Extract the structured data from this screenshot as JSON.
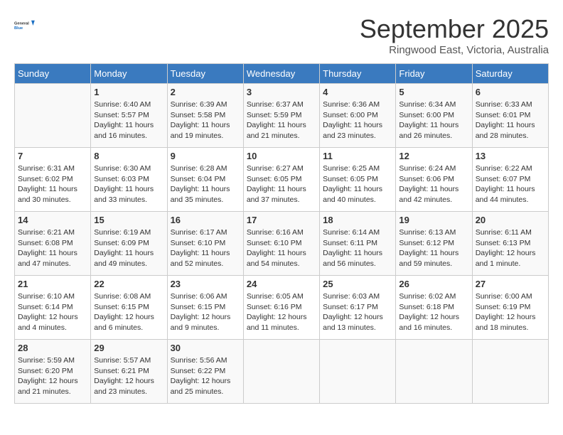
{
  "header": {
    "logo_line1": "General",
    "logo_line2": "Blue",
    "month": "September 2025",
    "location": "Ringwood East, Victoria, Australia"
  },
  "weekdays": [
    "Sunday",
    "Monday",
    "Tuesday",
    "Wednesday",
    "Thursday",
    "Friday",
    "Saturday"
  ],
  "weeks": [
    [
      {
        "day": "",
        "info": ""
      },
      {
        "day": "1",
        "info": "Sunrise: 6:40 AM\nSunset: 5:57 PM\nDaylight: 11 hours\nand 16 minutes."
      },
      {
        "day": "2",
        "info": "Sunrise: 6:39 AM\nSunset: 5:58 PM\nDaylight: 11 hours\nand 19 minutes."
      },
      {
        "day": "3",
        "info": "Sunrise: 6:37 AM\nSunset: 5:59 PM\nDaylight: 11 hours\nand 21 minutes."
      },
      {
        "day": "4",
        "info": "Sunrise: 6:36 AM\nSunset: 6:00 PM\nDaylight: 11 hours\nand 23 minutes."
      },
      {
        "day": "5",
        "info": "Sunrise: 6:34 AM\nSunset: 6:00 PM\nDaylight: 11 hours\nand 26 minutes."
      },
      {
        "day": "6",
        "info": "Sunrise: 6:33 AM\nSunset: 6:01 PM\nDaylight: 11 hours\nand 28 minutes."
      }
    ],
    [
      {
        "day": "7",
        "info": "Sunrise: 6:31 AM\nSunset: 6:02 PM\nDaylight: 11 hours\nand 30 minutes."
      },
      {
        "day": "8",
        "info": "Sunrise: 6:30 AM\nSunset: 6:03 PM\nDaylight: 11 hours\nand 33 minutes."
      },
      {
        "day": "9",
        "info": "Sunrise: 6:28 AM\nSunset: 6:04 PM\nDaylight: 11 hours\nand 35 minutes."
      },
      {
        "day": "10",
        "info": "Sunrise: 6:27 AM\nSunset: 6:05 PM\nDaylight: 11 hours\nand 37 minutes."
      },
      {
        "day": "11",
        "info": "Sunrise: 6:25 AM\nSunset: 6:05 PM\nDaylight: 11 hours\nand 40 minutes."
      },
      {
        "day": "12",
        "info": "Sunrise: 6:24 AM\nSunset: 6:06 PM\nDaylight: 11 hours\nand 42 minutes."
      },
      {
        "day": "13",
        "info": "Sunrise: 6:22 AM\nSunset: 6:07 PM\nDaylight: 11 hours\nand 44 minutes."
      }
    ],
    [
      {
        "day": "14",
        "info": "Sunrise: 6:21 AM\nSunset: 6:08 PM\nDaylight: 11 hours\nand 47 minutes."
      },
      {
        "day": "15",
        "info": "Sunrise: 6:19 AM\nSunset: 6:09 PM\nDaylight: 11 hours\nand 49 minutes."
      },
      {
        "day": "16",
        "info": "Sunrise: 6:17 AM\nSunset: 6:10 PM\nDaylight: 11 hours\nand 52 minutes."
      },
      {
        "day": "17",
        "info": "Sunrise: 6:16 AM\nSunset: 6:10 PM\nDaylight: 11 hours\nand 54 minutes."
      },
      {
        "day": "18",
        "info": "Sunrise: 6:14 AM\nSunset: 6:11 PM\nDaylight: 11 hours\nand 56 minutes."
      },
      {
        "day": "19",
        "info": "Sunrise: 6:13 AM\nSunset: 6:12 PM\nDaylight: 11 hours\nand 59 minutes."
      },
      {
        "day": "20",
        "info": "Sunrise: 6:11 AM\nSunset: 6:13 PM\nDaylight: 12 hours\nand 1 minute."
      }
    ],
    [
      {
        "day": "21",
        "info": "Sunrise: 6:10 AM\nSunset: 6:14 PM\nDaylight: 12 hours\nand 4 minutes."
      },
      {
        "day": "22",
        "info": "Sunrise: 6:08 AM\nSunset: 6:15 PM\nDaylight: 12 hours\nand 6 minutes."
      },
      {
        "day": "23",
        "info": "Sunrise: 6:06 AM\nSunset: 6:15 PM\nDaylight: 12 hours\nand 9 minutes."
      },
      {
        "day": "24",
        "info": "Sunrise: 6:05 AM\nSunset: 6:16 PM\nDaylight: 12 hours\nand 11 minutes."
      },
      {
        "day": "25",
        "info": "Sunrise: 6:03 AM\nSunset: 6:17 PM\nDaylight: 12 hours\nand 13 minutes."
      },
      {
        "day": "26",
        "info": "Sunrise: 6:02 AM\nSunset: 6:18 PM\nDaylight: 12 hours\nand 16 minutes."
      },
      {
        "day": "27",
        "info": "Sunrise: 6:00 AM\nSunset: 6:19 PM\nDaylight: 12 hours\nand 18 minutes."
      }
    ],
    [
      {
        "day": "28",
        "info": "Sunrise: 5:59 AM\nSunset: 6:20 PM\nDaylight: 12 hours\nand 21 minutes."
      },
      {
        "day": "29",
        "info": "Sunrise: 5:57 AM\nSunset: 6:21 PM\nDaylight: 12 hours\nand 23 minutes."
      },
      {
        "day": "30",
        "info": "Sunrise: 5:56 AM\nSunset: 6:22 PM\nDaylight: 12 hours\nand 25 minutes."
      },
      {
        "day": "",
        "info": ""
      },
      {
        "day": "",
        "info": ""
      },
      {
        "day": "",
        "info": ""
      },
      {
        "day": "",
        "info": ""
      }
    ]
  ]
}
